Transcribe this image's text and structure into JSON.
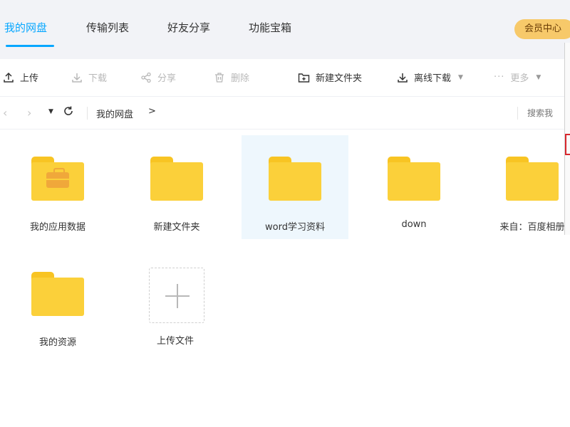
{
  "nav": {
    "tabs": [
      {
        "label": "我的网盘"
      },
      {
        "label": "传输列表"
      },
      {
        "label": "好友分享"
      },
      {
        "label": "功能宝箱"
      }
    ],
    "vip_label": "会员中心"
  },
  "toolbar": {
    "upload": "上传",
    "download": "下载",
    "share": "分享",
    "delete": "删除",
    "new_folder": "新建文件夹",
    "offline_download": "离线下载",
    "more": "更多"
  },
  "breadcrumb": {
    "current": "我的网盘",
    "arrow": ">"
  },
  "search": {
    "placeholder": "搜索我"
  },
  "files": [
    {
      "name": "我的应用数据"
    },
    {
      "name": "新建文件夹"
    },
    {
      "name": "word学习资料"
    },
    {
      "name": "down"
    },
    {
      "name": "来自：百度相册"
    },
    {
      "name": "我的资源"
    }
  ],
  "upload_tile": {
    "label": "上传文件"
  },
  "colors": {
    "accent": "#06a7ff",
    "folder": "#fbd03a",
    "vip": "#f7c96a",
    "selected_bg": "#eef7fd"
  }
}
